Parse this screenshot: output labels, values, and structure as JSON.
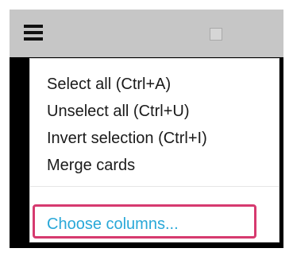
{
  "toolbar": {
    "menu_icon": "hamburger-menu-icon",
    "checkbox_icon": "checkbox-icon"
  },
  "menu": {
    "items": [
      {
        "label": "Select all (Ctrl+A)"
      },
      {
        "label": "Unselect all (Ctrl+U)"
      },
      {
        "label": "Invert selection (Ctrl+I)"
      },
      {
        "label": "Merge cards"
      }
    ],
    "choose_columns_label": "Choose columns..."
  },
  "colors": {
    "toolbar_bg": "#c6c6c6",
    "link": "#29a8d8",
    "highlight": "#d63a6f"
  }
}
